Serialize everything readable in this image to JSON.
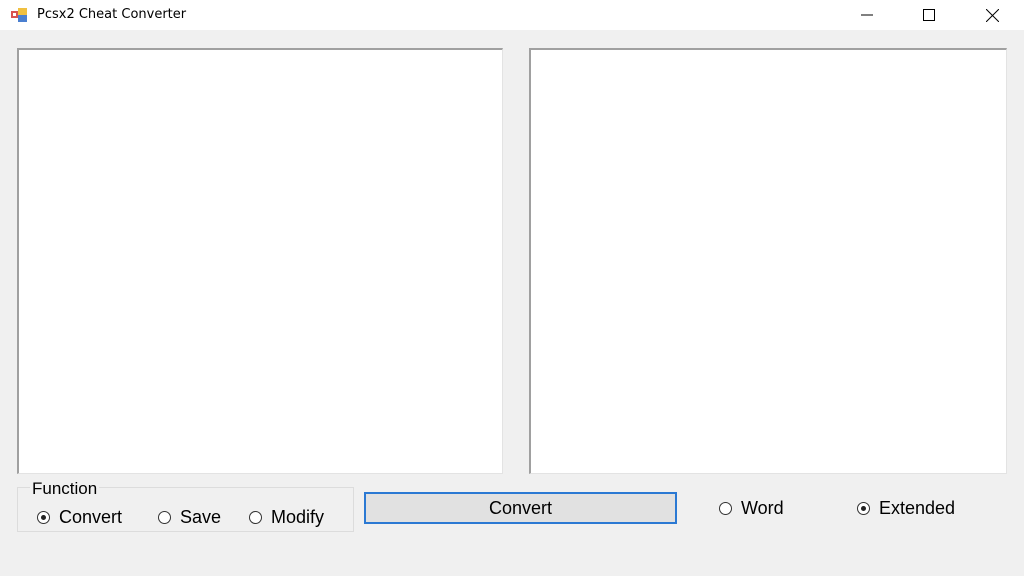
{
  "window": {
    "title": "Pcsx2 Cheat Converter",
    "icons": {
      "app": "app-window-icon",
      "minimize": "minimize-icon",
      "maximize": "maximize-icon",
      "close": "close-icon"
    }
  },
  "input_box": {
    "value": ""
  },
  "output_box": {
    "value": ""
  },
  "function_group": {
    "label": "Function",
    "options": [
      {
        "label": "Convert",
        "checked": true
      },
      {
        "label": "Save",
        "checked": false
      },
      {
        "label": "Modify",
        "checked": false
      }
    ]
  },
  "convert_button": {
    "label": "Convert"
  },
  "format_options": [
    {
      "label": "Word",
      "checked": false
    },
    {
      "label": "Extended",
      "checked": true
    }
  ],
  "colors": {
    "focus_border": "#2b79d3",
    "background": "#f0f0f0"
  }
}
